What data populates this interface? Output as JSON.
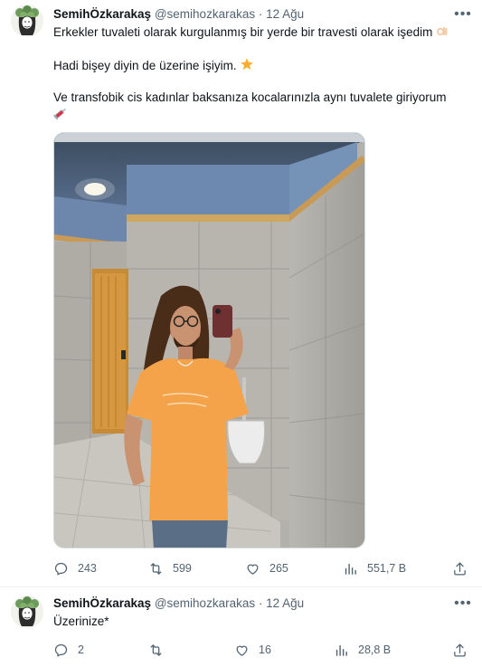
{
  "tweets": [
    {
      "author_name": "SemihÖzkarakaş",
      "handle": "@semihozkarakas",
      "separator": "·",
      "date": "12 Ağu",
      "text_line1": "Erkekler tuvaleti olarak kurgulanmış bir yerde bir travesti olarak işedim",
      "text_line2": "Hadi bişey diyin de üzerine işiyim.",
      "text_line3": "Ve transfobik cis kadınlar baksanıza kocalarınızla aynı tuvalete giriyorum",
      "emojis": [
        "ok-hand-emoji",
        "star-emoji",
        "syringe-emoji"
      ],
      "counts": {
        "replies": "243",
        "retweets": "599",
        "likes": "265",
        "views": "551,7 B"
      }
    },
    {
      "author_name": "SemihÖzkarakaş",
      "handle": "@semihozkarakas",
      "separator": "·",
      "date": "12 Ağu",
      "text": "Üzerinize*",
      "counts": {
        "replies": "2",
        "retweets": "",
        "likes": "16",
        "views": "28,8 B"
      }
    }
  ],
  "colors": {
    "text": "#0f1419",
    "secondary": "#536471",
    "border": "#cfd9de"
  },
  "icons": [
    "more-icon",
    "reply-icon",
    "retweet-icon",
    "like-icon",
    "views-icon",
    "share-icon"
  ]
}
